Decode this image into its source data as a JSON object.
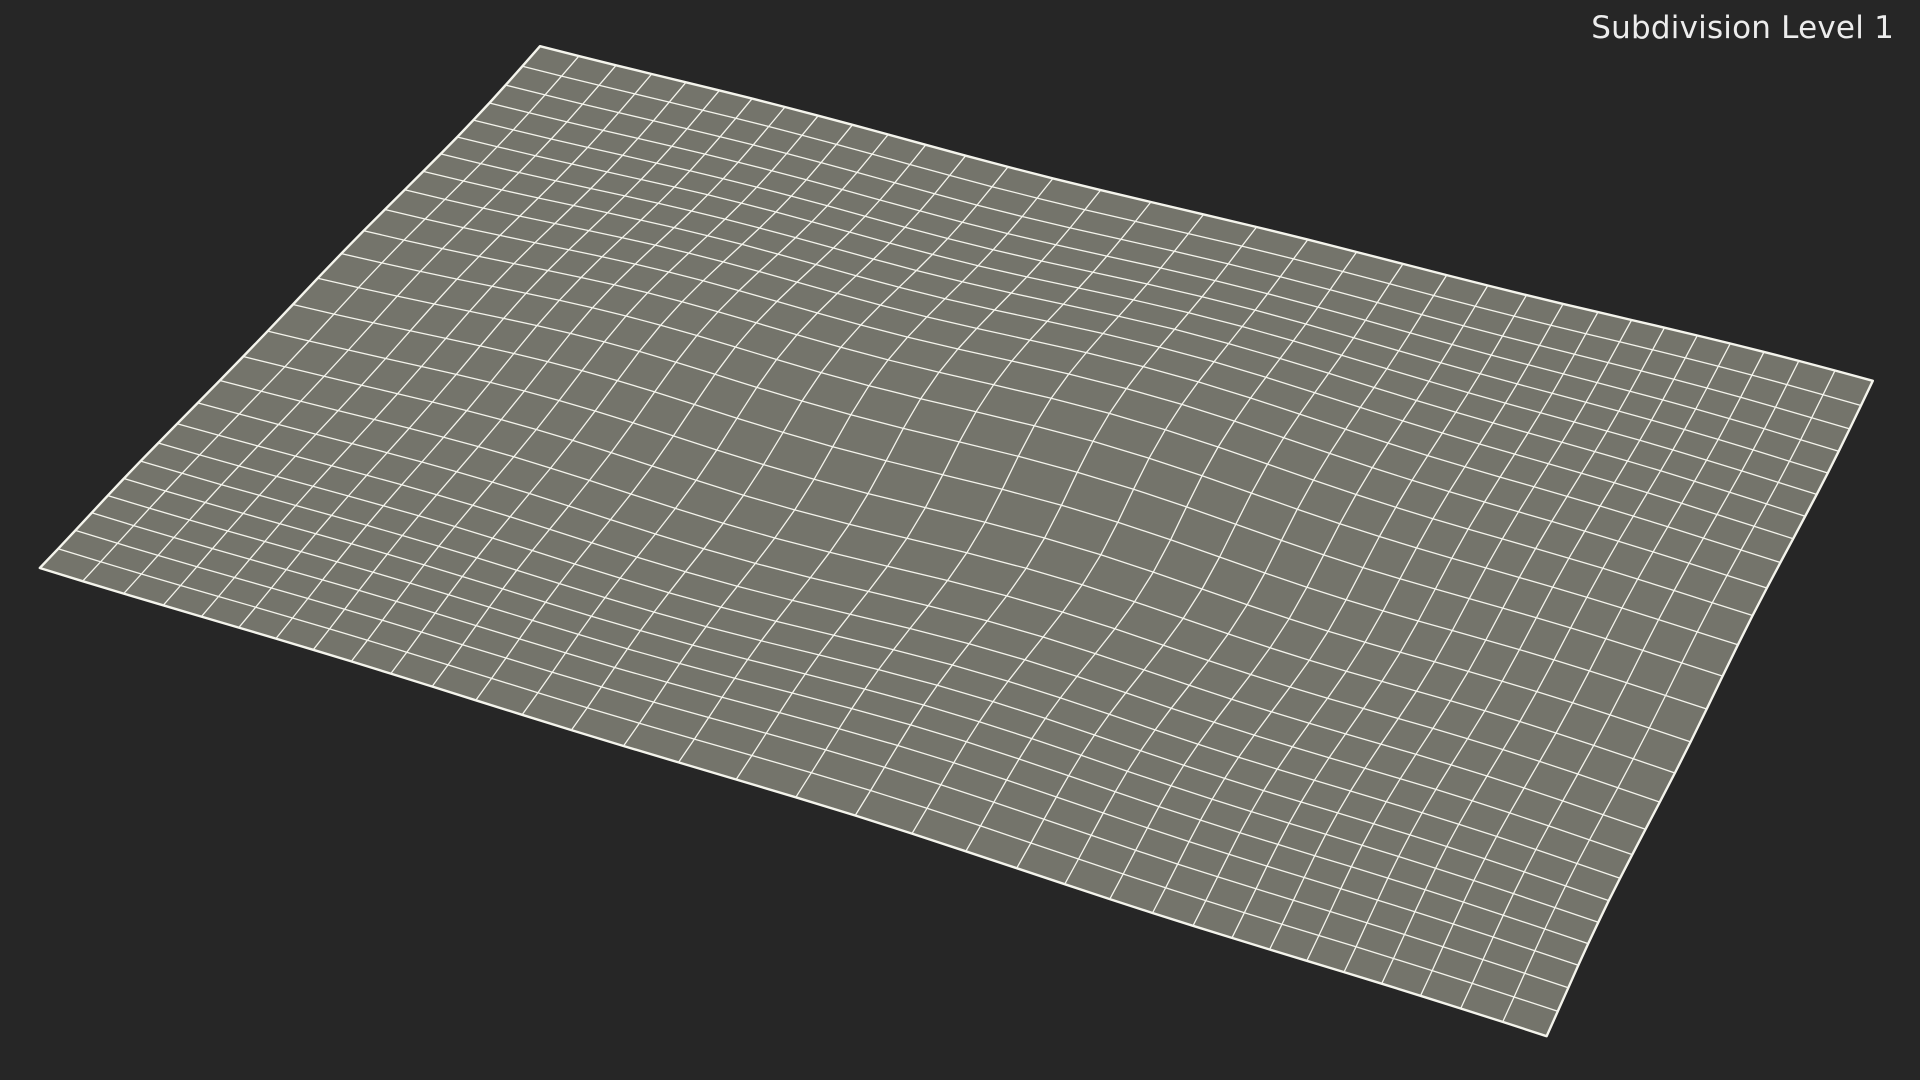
{
  "viewport": {
    "label": "Subdivision Level 1",
    "background_color": "#262626",
    "surface_color": "#74746b",
    "wire_color": "#f4f4ec"
  }
}
